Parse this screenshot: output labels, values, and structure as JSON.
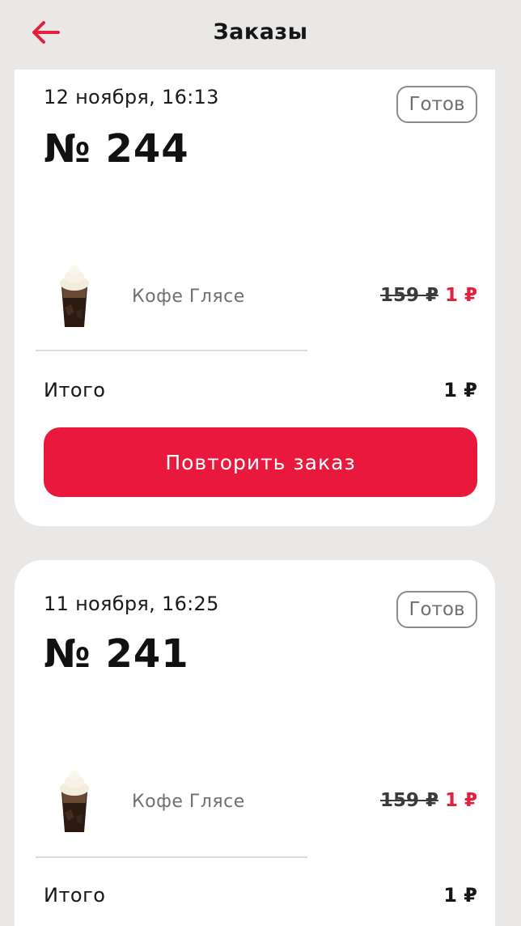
{
  "header": {
    "title": "Заказы",
    "back_icon": "arrow-left-icon"
  },
  "colors": {
    "accent": "#e8193c",
    "price_new": "#e3203f",
    "background": "#e9e8e6",
    "card": "#ffffff"
  },
  "orders": [
    {
      "date": "12 ноября, 16:13",
      "status": "Готов",
      "number": "№ 244",
      "item": {
        "name": "Кофе Глясе",
        "old_price": "159 ₽",
        "new_price": "1 ₽"
      },
      "total_label": "Итого",
      "total_value": "1 ₽",
      "repeat_label": "Повторить заказ"
    },
    {
      "date": "11 ноября, 16:25",
      "status": "Готов",
      "number": "№ 241",
      "item": {
        "name": "Кофе Глясе",
        "old_price": "159 ₽",
        "new_price": "1 ₽"
      },
      "total_label": "Итого",
      "total_value": "1 ₽"
    }
  ]
}
